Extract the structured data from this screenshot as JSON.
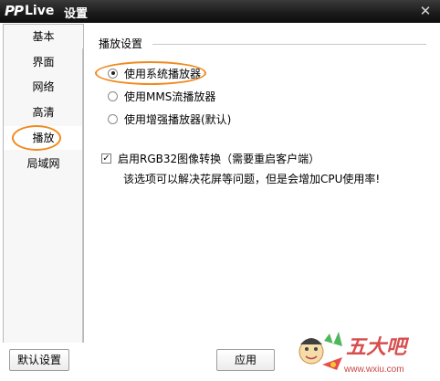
{
  "window": {
    "brand": {
      "pp": "PP",
      "live": "Live"
    },
    "title": "设置",
    "close_icon": "close-icon"
  },
  "sidebar": {
    "items": [
      {
        "label": "基本",
        "selected": false
      },
      {
        "label": "界面",
        "selected": false
      },
      {
        "label": "网络",
        "selected": false
      },
      {
        "label": "高清",
        "selected": false
      },
      {
        "label": "播放",
        "selected": true
      },
      {
        "label": "局域网",
        "selected": false
      }
    ]
  },
  "content": {
    "section_title": "播放设置",
    "radios": [
      {
        "label": "使用系统播放器",
        "checked": true
      },
      {
        "label": "使用MMS流播放器",
        "checked": false
      },
      {
        "label": "使用增强播放器(默认)",
        "checked": false
      }
    ],
    "checkbox": {
      "label": "启用RGB32图像转换（需要重启客户端）",
      "checked": true
    },
    "note": "该选项可以解决花屏等问题，但是会增加CPU使用率!"
  },
  "footer": {
    "default_label": "默认设置",
    "apply_label": "应用"
  },
  "colors": {
    "highlight": "#f08a1e",
    "titlebar": "#1a1a1a"
  },
  "watermark": {
    "text": "五大吧",
    "site": "www.wxiu.com"
  }
}
